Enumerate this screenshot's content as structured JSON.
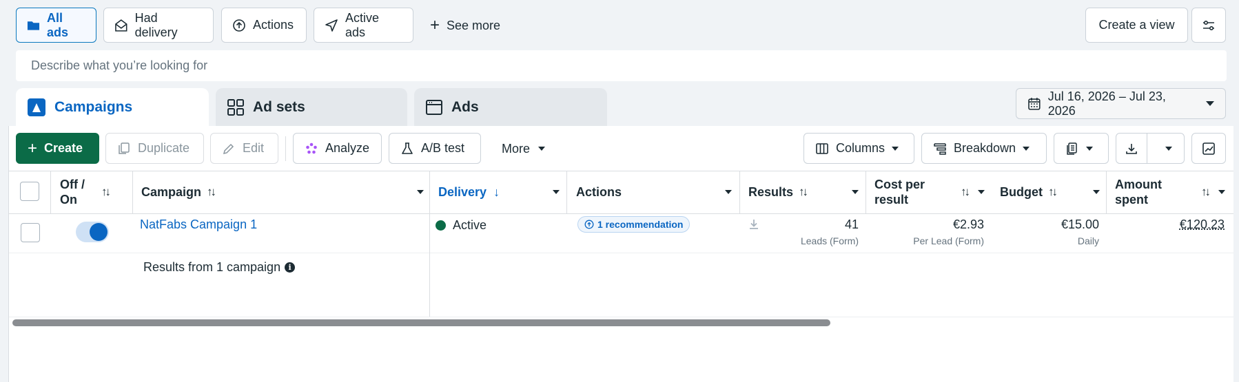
{
  "filters": {
    "all_ads": "All ads",
    "had_delivery": "Had delivery",
    "actions": "Actions",
    "active_ads": "Active ads",
    "see_more": "See more",
    "create_view": "Create a view"
  },
  "search": {
    "placeholder": "Describe what you’re looking for"
  },
  "tabs": {
    "campaigns": "Campaigns",
    "ad_sets": "Ad sets",
    "ads": "Ads"
  },
  "date_range": "Jul 16, 2026 – Jul 23, 2026",
  "toolbar": {
    "create": "Create",
    "duplicate": "Duplicate",
    "edit": "Edit",
    "analyze": "Analyze",
    "ab_test": "A/B test",
    "more": "More",
    "columns": "Columns",
    "breakdown": "Breakdown"
  },
  "table": {
    "headers": {
      "off_on_1": "Off /",
      "off_on_2": "On",
      "campaign": "Campaign",
      "delivery": "Delivery",
      "actions": "Actions",
      "results": "Results",
      "cost_1": "Cost per",
      "cost_2": "result",
      "budget": "Budget",
      "amount_1": "Amount",
      "amount_2": "spent"
    },
    "row": {
      "campaign": "NatFabs Campaign 1",
      "delivery": "Active",
      "recommendation": "1 recommendation",
      "results": "41",
      "results_sub": "Leads (Form)",
      "cost": "€2.93",
      "cost_sub": "Per Lead (Form)",
      "budget": "€15.00",
      "budget_sub": "Daily",
      "amount": "€120.23"
    },
    "footer": "Results from 1 campaign"
  },
  "colors": {
    "accent": "#0a66c2",
    "primary": "#0b6b47",
    "active_dot": "#0b6b47"
  }
}
